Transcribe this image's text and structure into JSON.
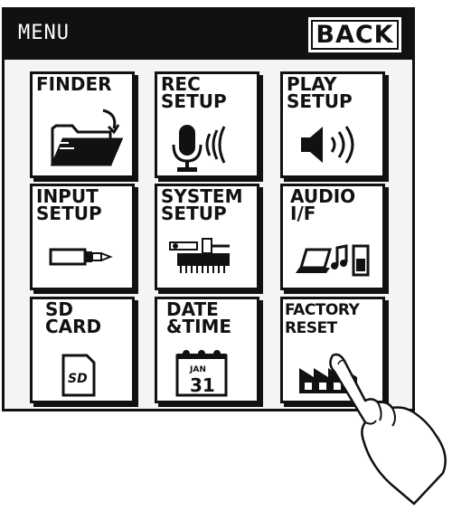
{
  "header": {
    "title": "MENU",
    "back_label": "BACK"
  },
  "tiles": [
    {
      "label": "FINDER",
      "icon": "folder-icon"
    },
    {
      "label": "REC\nSETUP",
      "icon": "microphone-icon"
    },
    {
      "label": "PLAY\nSETUP",
      "icon": "speaker-icon"
    },
    {
      "label": "INPUT\nSETUP",
      "icon": "input-jack-icon"
    },
    {
      "label": "SYSTEM\nSETUP",
      "icon": "chip-icon"
    },
    {
      "label": "AUDIO\nI/F",
      "icon": "computer-music-icon"
    },
    {
      "label": "SD\nCARD",
      "icon": "sd-card-icon"
    },
    {
      "label": "DATE\n&TIME",
      "icon": "calendar-icon"
    },
    {
      "label": "FACTORY\nRESET",
      "icon": "factory-icon"
    }
  ],
  "calendar": {
    "month": "JAN",
    "day": "31"
  },
  "sd_card": {
    "text": "SD"
  }
}
